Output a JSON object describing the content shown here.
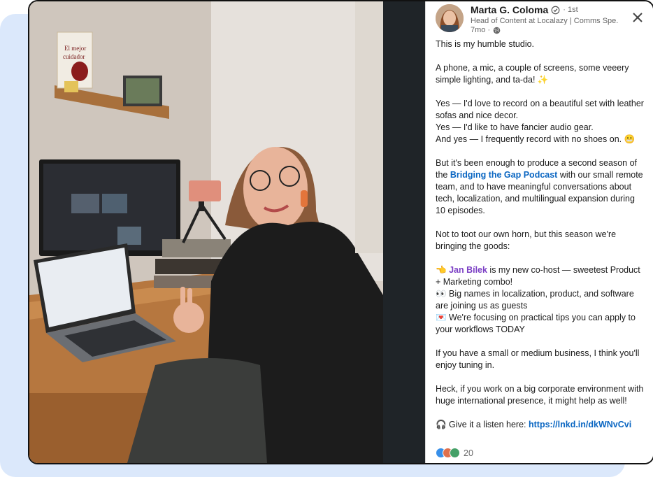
{
  "post": {
    "author": {
      "name": "Marta G. Coloma",
      "degree": "· 1st",
      "headline": "Head of Content at Localazy | Comms Spe...",
      "time": "7mo ·"
    },
    "body": {
      "p1": "This is my humble studio.",
      "p2": "A phone, a mic, a couple of screens, some veeery simple lighting, and ta-da! ✨",
      "p3_line1": "Yes — I'd love to record on a beautiful set with leather sofas and nice decor.",
      "p3_line2": "Yes — I'd like to have fancier audio gear.",
      "p3_line3": "And yes — I frequently record with no shoes on. 😬",
      "p4_pre": "But it's been enough to produce a second season of the ",
      "p4_link": "Bridging the Gap Podcast",
      "p4_post": " with our small remote team, and to have meaningful conversations about tech, localization, and multilingual expansion during 10 episodes.",
      "p5": "Not to toot our own horn, but this season we're bringing the goods:",
      "b1_icon": "👈",
      "b1_mention": "Jan Bílek",
      "b1_text": " is my new co-host — sweetest Product + Marketing combo!",
      "b2": "👀 Big names in localization, product, and software are joining us as guests",
      "b3": "💌 We're focusing on practical tips you can apply to your workflows TODAY",
      "p6": "If you have a small or medium business, I think you'll enjoy tuning in.",
      "p7": "Heck, if you work on a big corporate environment with huge international presence, it might help as well!",
      "p8_pre": "🎧 Give it a listen here: ",
      "p8_link": "https://lnkd.in/dkWNvCvi"
    },
    "reactions": {
      "count": "20",
      "types": [
        "like-icon",
        "love-icon",
        "celebrate-icon"
      ]
    }
  },
  "photo": {
    "book_title": "El mejor cuidador",
    "description_icons": [
      "photo"
    ]
  },
  "colors": {
    "link": "#0a66c2",
    "mention": "#7b3fc4",
    "background_card": "#dbe8fb"
  }
}
